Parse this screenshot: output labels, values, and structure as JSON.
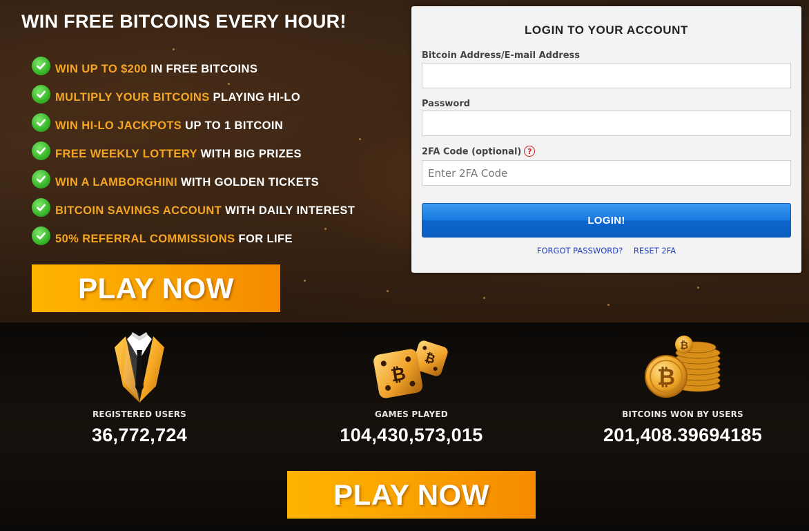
{
  "hero": {
    "headline": "WIN FREE BITCOINS EVERY HOUR!",
    "features": [
      {
        "highlight": "WIN UP TO $200",
        "rest": " IN FREE BITCOINS"
      },
      {
        "highlight": "MULTIPLY YOUR BITCOINS",
        "rest": " PLAYING HI-LO"
      },
      {
        "highlight": "WIN HI-LO JACKPOTS",
        "rest": " UP TO 1 BITCOIN"
      },
      {
        "highlight": "FREE WEEKLY LOTTERY",
        "rest": " WITH BIG PRIZES"
      },
      {
        "highlight": "WIN A LAMBORGHINI",
        "rest": " WITH GOLDEN TICKETS"
      },
      {
        "highlight": "BITCOIN SAVINGS ACCOUNT",
        "rest": " WITH DAILY INTEREST"
      },
      {
        "highlight": "50% REFERRAL COMMISSIONS",
        "rest": " FOR LIFE"
      }
    ],
    "play_label": "PLAY NOW"
  },
  "login": {
    "title": "LOGIN TO YOUR ACCOUNT",
    "address_label": "Bitcoin Address/E-mail Address",
    "address_value": "",
    "password_label": "Password",
    "password_value": "",
    "twofa_label": "2FA Code (optional)",
    "twofa_help": "?",
    "twofa_placeholder": "Enter 2FA Code",
    "button_label": "LOGIN!",
    "forgot_link": "FORGOT PASSWORD?",
    "reset_link": "RESET 2FA"
  },
  "stats": [
    {
      "icon": "tuxedo-icon",
      "label": "REGISTERED USERS",
      "value": "36,772,724"
    },
    {
      "icon": "dice-icon",
      "label": "GAMES PLAYED",
      "value": "104,430,573,015"
    },
    {
      "icon": "bitcoin-coins-icon",
      "label": "BITCOINS WON BY USERS",
      "value": "201,408.39694185"
    }
  ],
  "footer": {
    "play_label": "PLAY NOW"
  },
  "colors": {
    "accent_orange": "#f5a623",
    "check_green": "#39b62a",
    "login_blue": "#0d64cc",
    "link_blue": "#1f3fc6"
  }
}
